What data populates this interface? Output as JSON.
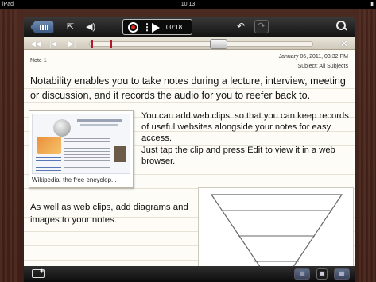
{
  "status_bar": {
    "device": "iPad",
    "time": "10:13"
  },
  "toolbar": {
    "back_icon": "notes-list-icon",
    "share_icon": "share-icon",
    "volume_icon": "speaker-icon",
    "record_icon": "record-icon",
    "menu_icon": "vertical-dots-icon",
    "play_icon": "play-icon",
    "record_time": "00:18",
    "undo_icon": "undo-icon",
    "redo_icon": "redo-icon",
    "search_icon": "search-icon"
  },
  "scrubber": {
    "position_fraction": 0.58
  },
  "note": {
    "title": "Note 1",
    "date": "January 06, 2011, 03:32 PM",
    "subject": "Subject: All Subjects",
    "intro": "Notability enables you to take notes during a lecture, interview, meeting or discussion, and it records the audio for you to reefer back to.",
    "clip_caption": "Wikipedia, the free encyclop...",
    "clip_text_1": "You can add web clips, so that you can keep records of useful websites alongside your notes for easy access.",
    "clip_text_2": "Just tap the clip and press Edit to view it in a web browser.",
    "diagram_text": "As well as web clips, add diagrams and images to your notes."
  },
  "bottom_bar": {
    "share_icon": "add-page-icon",
    "left_button_icon": "page-layout-icon",
    "middle_button_icon": "page-icon",
    "right_button_icon": "page-grid-icon"
  },
  "colors": {
    "toolbar": "#1a1a1a",
    "paper": "#fdfcf7",
    "leather": "#3b1f18",
    "record_red": "#e22222",
    "scrub_marker": "#b1182a"
  }
}
